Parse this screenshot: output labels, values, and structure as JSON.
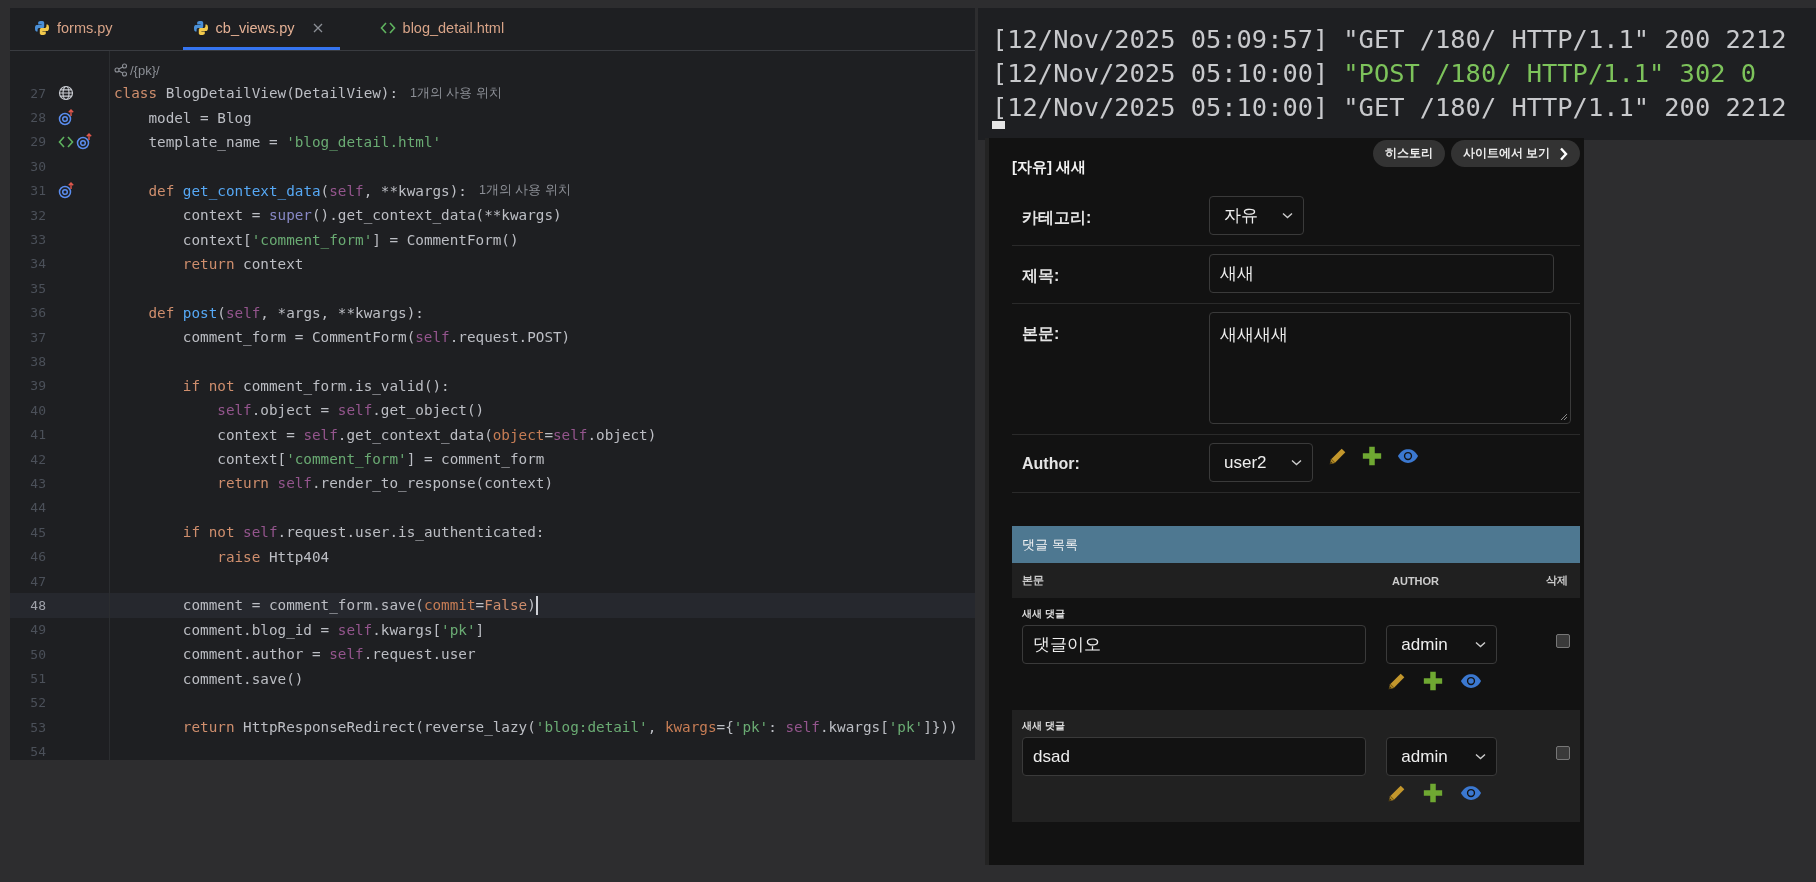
{
  "editor": {
    "tabs": [
      {
        "label": "forms.py",
        "kind": "python",
        "selected": false,
        "closable": false
      },
      {
        "label": "cb_views.py",
        "kind": "python",
        "selected": true,
        "closable": true
      },
      {
        "label": "blog_detail.html",
        "kind": "html",
        "selected": false,
        "closable": false
      }
    ],
    "route_hint": "/{pk}/",
    "lines": [
      {
        "number": "27",
        "current": false,
        "markers": [
          {
            "kind": "globe"
          }
        ],
        "tokens": [
          {
            "kind": "kw",
            "text": "class"
          },
          {
            "kind": "plain",
            "text": " BlogDetailView(DetailView):"
          }
        ],
        "hint": "1개의 사용 위치"
      },
      {
        "number": "28",
        "current": false,
        "markers": [
          {
            "kind": "override"
          }
        ],
        "tokens": [
          {
            "kind": "plain",
            "text": "    model = Blog"
          }
        ]
      },
      {
        "number": "29",
        "current": false,
        "markers": [
          {
            "kind": "html"
          },
          {
            "kind": "override"
          }
        ],
        "tokens": [
          {
            "kind": "plain",
            "text": "    template_name = "
          },
          {
            "kind": "str",
            "text": "'blog_detail.html'"
          }
        ]
      },
      {
        "number": "30",
        "current": false
      },
      {
        "number": "31",
        "current": false,
        "markers": [
          {
            "kind": "override"
          }
        ],
        "tokens": [
          {
            "kind": "kw",
            "text": "    def"
          },
          {
            "kind": "fn",
            "text": " get_context_data"
          },
          {
            "kind": "plain",
            "text": "("
          },
          {
            "kind": "self",
            "text": "self"
          },
          {
            "kind": "plain",
            "text": ", **kwargs):"
          }
        ],
        "hint": "1개의 사용 위치"
      },
      {
        "number": "32",
        "current": false,
        "tokens": [
          {
            "kind": "plain",
            "text": "        context = "
          },
          {
            "kind": "builtin",
            "text": "super"
          },
          {
            "kind": "plain",
            "text": "().get_context_data(**kwargs)"
          }
        ]
      },
      {
        "number": "33",
        "current": false,
        "tokens": [
          {
            "kind": "plain",
            "text": "        context["
          },
          {
            "kind": "str",
            "text": "'comment_form'"
          },
          {
            "kind": "plain",
            "text": "] = CommentForm()"
          }
        ]
      },
      {
        "number": "34",
        "current": false,
        "tokens": [
          {
            "kind": "kw",
            "text": "        return"
          },
          {
            "kind": "plain",
            "text": " context"
          }
        ]
      },
      {
        "number": "35",
        "current": false
      },
      {
        "number": "36",
        "current": false,
        "tokens": [
          {
            "kind": "kw",
            "text": "    def"
          },
          {
            "kind": "fn",
            "text": " post"
          },
          {
            "kind": "plain",
            "text": "("
          },
          {
            "kind": "self",
            "text": "self"
          },
          {
            "kind": "plain",
            "text": ", *args, **kwargs):"
          }
        ]
      },
      {
        "number": "37",
        "current": false,
        "tokens": [
          {
            "kind": "plain",
            "text": "        comment_form = CommentForm("
          },
          {
            "kind": "self",
            "text": "self"
          },
          {
            "kind": "plain",
            "text": ".request.POST)"
          }
        ]
      },
      {
        "number": "38",
        "current": false
      },
      {
        "number": "39",
        "current": false,
        "tokens": [
          {
            "kind": "kw",
            "text": "        if not"
          },
          {
            "kind": "plain",
            "text": " comment_form.is_valid():"
          }
        ]
      },
      {
        "number": "40",
        "current": false,
        "tokens": [
          {
            "kind": "self",
            "text": "            self"
          },
          {
            "kind": "plain",
            "text": ".object = "
          },
          {
            "kind": "self",
            "text": "self"
          },
          {
            "kind": "plain",
            "text": ".get_object()"
          }
        ]
      },
      {
        "number": "41",
        "current": false,
        "tokens": [
          {
            "kind": "plain",
            "text": "            context = "
          },
          {
            "kind": "self",
            "text": "self"
          },
          {
            "kind": "plain",
            "text": ".get_context_data("
          },
          {
            "kind": "param",
            "text": "object"
          },
          {
            "kind": "plain",
            "text": "="
          },
          {
            "kind": "self",
            "text": "self"
          },
          {
            "kind": "plain",
            "text": ".object)"
          }
        ]
      },
      {
        "number": "42",
        "current": false,
        "tokens": [
          {
            "kind": "plain",
            "text": "            context["
          },
          {
            "kind": "str",
            "text": "'comment_form'"
          },
          {
            "kind": "plain",
            "text": "] = comment_form"
          }
        ]
      },
      {
        "number": "43",
        "current": false,
        "tokens": [
          {
            "kind": "kw",
            "text": "            return"
          },
          {
            "kind": "self",
            "text": " self"
          },
          {
            "kind": "plain",
            "text": ".render_to_response(context)"
          }
        ]
      },
      {
        "number": "44",
        "current": false
      },
      {
        "number": "45",
        "current": false,
        "tokens": [
          {
            "kind": "kw",
            "text": "        if not"
          },
          {
            "kind": "self",
            "text": " self"
          },
          {
            "kind": "plain",
            "text": ".request.user.is_authenticated:"
          }
        ]
      },
      {
        "number": "46",
        "current": false,
        "tokens": [
          {
            "kind": "kw",
            "text": "            raise"
          },
          {
            "kind": "plain",
            "text": " Http404"
          }
        ]
      },
      {
        "number": "47",
        "current": false
      },
      {
        "number": "48",
        "current": true,
        "tokens": [
          {
            "kind": "plain",
            "text": "        comment = comment_form.save("
          },
          {
            "kind": "param",
            "text": "commit"
          },
          {
            "kind": "plain",
            "text": "="
          },
          {
            "kind": "kw",
            "text": "False"
          },
          {
            "kind": "plain",
            "text": ")"
          }
        ]
      },
      {
        "number": "49",
        "current": false,
        "tokens": [
          {
            "kind": "plain",
            "text": "        comment.blog_id = "
          },
          {
            "kind": "self",
            "text": "self"
          },
          {
            "kind": "plain",
            "text": ".kwargs["
          },
          {
            "kind": "str",
            "text": "'pk'"
          },
          {
            "kind": "plain",
            "text": "]"
          }
        ]
      },
      {
        "number": "50",
        "current": false,
        "tokens": [
          {
            "kind": "plain",
            "text": "        comment.author = "
          },
          {
            "kind": "self",
            "text": "self"
          },
          {
            "kind": "plain",
            "text": ".request.user"
          }
        ]
      },
      {
        "number": "51",
        "current": false,
        "tokens": [
          {
            "kind": "plain",
            "text": "        comment.save()"
          }
        ]
      },
      {
        "number": "52",
        "current": false
      },
      {
        "number": "53",
        "current": false,
        "tokens": [
          {
            "kind": "kw",
            "text": "        return"
          },
          {
            "kind": "plain",
            "text": " HttpResponseRedirect(reverse_lazy("
          },
          {
            "kind": "str",
            "text": "'blog:detail'"
          },
          {
            "kind": "plain",
            "text": ", "
          },
          {
            "kind": "param",
            "text": "kwargs"
          },
          {
            "kind": "plain",
            "text": "={"
          },
          {
            "kind": "str",
            "text": "'pk'"
          },
          {
            "kind": "plain",
            "text": ": "
          },
          {
            "kind": "self",
            "text": "self"
          },
          {
            "kind": "plain",
            "text": ".kwargs["
          },
          {
            "kind": "str",
            "text": "'pk'"
          },
          {
            "kind": "plain",
            "text": "]}))"
          }
        ]
      },
      {
        "number": "54",
        "current": false
      }
    ]
  },
  "terminal": {
    "lines": [
      {
        "timestamp": "[12/Nov/2025 05:09:57]",
        "request": "\"GET /180/ HTTP/1.1\" 200 2212",
        "highlight": false
      },
      {
        "timestamp": "[12/Nov/2025 05:10:00]",
        "request": "\"POST /180/ HTTP/1.1\" 302 0",
        "highlight": true
      },
      {
        "timestamp": "[12/Nov/2025 05:10:00]",
        "request": "\"GET /180/ HTTP/1.1\" 200 2212",
        "highlight": false
      }
    ]
  },
  "admin": {
    "title": "[자유] 새새",
    "actions": [
      {
        "label": "히스토리",
        "chevron": false
      },
      {
        "label": "사이트에서 보기",
        "chevron": true
      }
    ],
    "fields": [
      {
        "label": "카테고리:",
        "kind": "select",
        "value": "자유"
      },
      {
        "label": "제목:",
        "kind": "text",
        "value": "새새"
      },
      {
        "label": "본문:",
        "kind": "textarea",
        "value": "새새새새"
      },
      {
        "label": "Author:",
        "kind": "select",
        "value": "user2",
        "related_actions": true
      }
    ],
    "inline": {
      "title": "댓글 목록",
      "columns": [
        "본문",
        "AUTHOR",
        "삭제"
      ],
      "rows": [
        {
          "label": "새새 댓글",
          "body": "댓글이오",
          "author": "admin",
          "delete": false
        },
        {
          "label": "새새 댓글",
          "body": "dsad",
          "author": "admin",
          "delete": false
        }
      ]
    }
  }
}
